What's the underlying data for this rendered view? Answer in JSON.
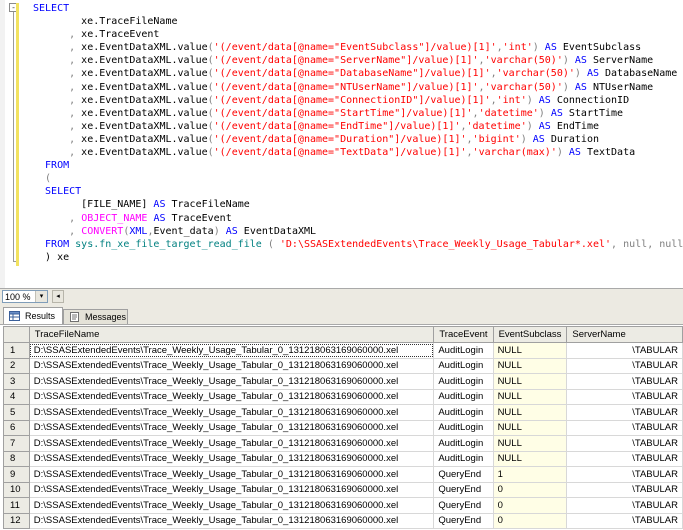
{
  "editor": {
    "collapse_glyph": "-",
    "lines": [
      [
        {
          "t": "SELECT",
          "c": "kw"
        }
      ],
      [
        {
          "t": "        xe.TraceFileName",
          "c": ""
        }
      ],
      [
        {
          "t": "      ",
          "c": ""
        },
        {
          "t": ",",
          "c": "gr"
        },
        {
          "t": " xe.TraceEvent",
          "c": ""
        }
      ],
      [
        {
          "t": "      ",
          "c": ""
        },
        {
          "t": ",",
          "c": "gr"
        },
        {
          "t": " xe.EventDataXML.value",
          "c": ""
        },
        {
          "t": "(",
          "c": "gr"
        },
        {
          "t": "'(/event/data[@name=\"EventSubclass\"]/value)[1]'",
          "c": "str"
        },
        {
          "t": ",",
          "c": "gr"
        },
        {
          "t": "'int'",
          "c": "str"
        },
        {
          "t": ") ",
          "c": "gr"
        },
        {
          "t": "AS",
          "c": "kw"
        },
        {
          "t": " EventSubclass",
          "c": ""
        }
      ],
      [
        {
          "t": "      ",
          "c": ""
        },
        {
          "t": ",",
          "c": "gr"
        },
        {
          "t": " xe.EventDataXML.value",
          "c": ""
        },
        {
          "t": "(",
          "c": "gr"
        },
        {
          "t": "'(/event/data[@name=\"ServerName\"]/value)[1]'",
          "c": "str"
        },
        {
          "t": ",",
          "c": "gr"
        },
        {
          "t": "'varchar(50)'",
          "c": "str"
        },
        {
          "t": ") ",
          "c": "gr"
        },
        {
          "t": "AS",
          "c": "kw"
        },
        {
          "t": " ServerName",
          "c": ""
        }
      ],
      [
        {
          "t": "      ",
          "c": ""
        },
        {
          "t": ",",
          "c": "gr"
        },
        {
          "t": " xe.EventDataXML.value",
          "c": ""
        },
        {
          "t": "(",
          "c": "gr"
        },
        {
          "t": "'(/event/data[@name=\"DatabaseName\"]/value)[1]'",
          "c": "str"
        },
        {
          "t": ",",
          "c": "gr"
        },
        {
          "t": "'varchar(50)'",
          "c": "str"
        },
        {
          "t": ") ",
          "c": "gr"
        },
        {
          "t": "AS",
          "c": "kw"
        },
        {
          "t": " DatabaseName",
          "c": ""
        }
      ],
      [
        {
          "t": "      ",
          "c": ""
        },
        {
          "t": ",",
          "c": "gr"
        },
        {
          "t": " xe.EventDataXML.value",
          "c": ""
        },
        {
          "t": "(",
          "c": "gr"
        },
        {
          "t": "'(/event/data[@name=\"NTUserName\"]/value)[1]'",
          "c": "str"
        },
        {
          "t": ",",
          "c": "gr"
        },
        {
          "t": "'varchar(50)'",
          "c": "str"
        },
        {
          "t": ") ",
          "c": "gr"
        },
        {
          "t": "AS",
          "c": "kw"
        },
        {
          "t": " NTUserName",
          "c": ""
        }
      ],
      [
        {
          "t": "      ",
          "c": ""
        },
        {
          "t": ",",
          "c": "gr"
        },
        {
          "t": " xe.EventDataXML.value",
          "c": ""
        },
        {
          "t": "(",
          "c": "gr"
        },
        {
          "t": "'(/event/data[@name=\"ConnectionID\"]/value)[1]'",
          "c": "str"
        },
        {
          "t": ",",
          "c": "gr"
        },
        {
          "t": "'int'",
          "c": "str"
        },
        {
          "t": ") ",
          "c": "gr"
        },
        {
          "t": "AS",
          "c": "kw"
        },
        {
          "t": " ConnectionID",
          "c": ""
        }
      ],
      [
        {
          "t": "      ",
          "c": ""
        },
        {
          "t": ",",
          "c": "gr"
        },
        {
          "t": " xe.EventDataXML.value",
          "c": ""
        },
        {
          "t": "(",
          "c": "gr"
        },
        {
          "t": "'(/event/data[@name=\"StartTime\"]/value)[1]'",
          "c": "str"
        },
        {
          "t": ",",
          "c": "gr"
        },
        {
          "t": "'datetime'",
          "c": "str"
        },
        {
          "t": ") ",
          "c": "gr"
        },
        {
          "t": "AS",
          "c": "kw"
        },
        {
          "t": " StartTime",
          "c": ""
        }
      ],
      [
        {
          "t": "      ",
          "c": ""
        },
        {
          "t": ",",
          "c": "gr"
        },
        {
          "t": " xe.EventDataXML.value",
          "c": ""
        },
        {
          "t": "(",
          "c": "gr"
        },
        {
          "t": "'(/event/data[@name=\"EndTime\"]/value)[1]'",
          "c": "str"
        },
        {
          "t": ",",
          "c": "gr"
        },
        {
          "t": "'datetime'",
          "c": "str"
        },
        {
          "t": ") ",
          "c": "gr"
        },
        {
          "t": "AS",
          "c": "kw"
        },
        {
          "t": " EndTime",
          "c": ""
        }
      ],
      [
        {
          "t": "      ",
          "c": ""
        },
        {
          "t": ",",
          "c": "gr"
        },
        {
          "t": " xe.EventDataXML.value",
          "c": ""
        },
        {
          "t": "(",
          "c": "gr"
        },
        {
          "t": "'(/event/data[@name=\"Duration\"]/value)[1]'",
          "c": "str"
        },
        {
          "t": ",",
          "c": "gr"
        },
        {
          "t": "'bigint'",
          "c": "str"
        },
        {
          "t": ") ",
          "c": "gr"
        },
        {
          "t": "AS",
          "c": "kw"
        },
        {
          "t": " Duration",
          "c": ""
        }
      ],
      [
        {
          "t": "      ",
          "c": ""
        },
        {
          "t": ",",
          "c": "gr"
        },
        {
          "t": " xe.EventDataXML.value",
          "c": ""
        },
        {
          "t": "(",
          "c": "gr"
        },
        {
          "t": "'(/event/data[@name=\"TextData\"]/value)[1]'",
          "c": "str"
        },
        {
          "t": ",",
          "c": "gr"
        },
        {
          "t": "'varchar(max)'",
          "c": "str"
        },
        {
          "t": ") ",
          "c": "gr"
        },
        {
          "t": "AS",
          "c": "kw"
        },
        {
          "t": " TextData",
          "c": ""
        }
      ],
      [
        {
          "t": "  FROM",
          "c": "kw"
        }
      ],
      [
        {
          "t": "  (",
          "c": "gr"
        }
      ],
      [
        {
          "t": "  SELECT",
          "c": "kw"
        }
      ],
      [
        {
          "t": "        [FILE_NAME] ",
          "c": ""
        },
        {
          "t": "AS",
          "c": "kw"
        },
        {
          "t": " TraceFileName",
          "c": ""
        }
      ],
      [
        {
          "t": "      ",
          "c": ""
        },
        {
          "t": ",",
          "c": "gr"
        },
        {
          "t": " ",
          "c": ""
        },
        {
          "t": "OBJECT_NAME",
          "c": "fn"
        },
        {
          "t": " ",
          "c": ""
        },
        {
          "t": "AS",
          "c": "kw"
        },
        {
          "t": " TraceEvent",
          "c": ""
        }
      ],
      [
        {
          "t": "      ",
          "c": ""
        },
        {
          "t": ",",
          "c": "gr"
        },
        {
          "t": " ",
          "c": ""
        },
        {
          "t": "CONVERT",
          "c": "fn"
        },
        {
          "t": "(",
          "c": "gr"
        },
        {
          "t": "XML",
          "c": "kw"
        },
        {
          "t": ",",
          "c": "gr"
        },
        {
          "t": "Event_data",
          "c": ""
        },
        {
          "t": ") ",
          "c": "gr"
        },
        {
          "t": "AS",
          "c": "kw"
        },
        {
          "t": " EventDataXML",
          "c": ""
        }
      ],
      [
        {
          "t": "  FROM",
          "c": "kw"
        },
        {
          "t": " ",
          "c": ""
        },
        {
          "t": "sys.fn_xe_file_target_read_file",
          "c": "nm"
        },
        {
          "t": " ",
          "c": ""
        },
        {
          "t": "(",
          "c": "gr"
        },
        {
          "t": " ",
          "c": ""
        },
        {
          "t": "'D:\\SSASExtendedEvents\\Trace_Weekly_Usage_Tabular*.xel'",
          "c": "str"
        },
        {
          "t": ",",
          "c": "gr"
        },
        {
          "t": " ",
          "c": ""
        },
        {
          "t": "null",
          "c": "gr"
        },
        {
          "t": ",",
          "c": "gr"
        },
        {
          "t": " ",
          "c": ""
        },
        {
          "t": "null",
          "c": "gr"
        },
        {
          "t": ",",
          "c": "gr"
        },
        {
          "t": " ",
          "c": ""
        },
        {
          "t": "null",
          "c": "gr"
        },
        {
          "t": " )",
          "c": "gr"
        }
      ],
      [
        {
          "t": "  ) xe",
          "c": ""
        }
      ]
    ]
  },
  "zoom": {
    "value": "100 %",
    "arrow": "▾",
    "scroll_left": "◂"
  },
  "tabs": [
    {
      "label": "Results",
      "active": true
    },
    {
      "label": "Messages",
      "active": false
    }
  ],
  "grid": {
    "columns": [
      "TraceFileName",
      "TraceEvent",
      "EventSubclass",
      "ServerName"
    ],
    "selected_row": 0,
    "rows": [
      {
        "n": "1",
        "file": "D:\\SSASExtendedEvents\\Trace_Weekly_Usage_Tabular_0_131218063169060000.xel",
        "event": "AuditLogin",
        "sub": "NULL",
        "server": "\\TABULAR"
      },
      {
        "n": "2",
        "file": "D:\\SSASExtendedEvents\\Trace_Weekly_Usage_Tabular_0_131218063169060000.xel",
        "event": "AuditLogin",
        "sub": "NULL",
        "server": "\\TABULAR"
      },
      {
        "n": "3",
        "file": "D:\\SSASExtendedEvents\\Trace_Weekly_Usage_Tabular_0_131218063169060000.xel",
        "event": "AuditLogin",
        "sub": "NULL",
        "server": "\\TABULAR"
      },
      {
        "n": "4",
        "file": "D:\\SSASExtendedEvents\\Trace_Weekly_Usage_Tabular_0_131218063169060000.xel",
        "event": "AuditLogin",
        "sub": "NULL",
        "server": "\\TABULAR"
      },
      {
        "n": "5",
        "file": "D:\\SSASExtendedEvents\\Trace_Weekly_Usage_Tabular_0_131218063169060000.xel",
        "event": "AuditLogin",
        "sub": "NULL",
        "server": "\\TABULAR"
      },
      {
        "n": "6",
        "file": "D:\\SSASExtendedEvents\\Trace_Weekly_Usage_Tabular_0_131218063169060000.xel",
        "event": "AuditLogin",
        "sub": "NULL",
        "server": "\\TABULAR"
      },
      {
        "n": "7",
        "file": "D:\\SSASExtendedEvents\\Trace_Weekly_Usage_Tabular_0_131218063169060000.xel",
        "event": "AuditLogin",
        "sub": "NULL",
        "server": "\\TABULAR"
      },
      {
        "n": "8",
        "file": "D:\\SSASExtendedEvents\\Trace_Weekly_Usage_Tabular_0_131218063169060000.xel",
        "event": "AuditLogin",
        "sub": "NULL",
        "server": "\\TABULAR"
      },
      {
        "n": "9",
        "file": "D:\\SSASExtendedEvents\\Trace_Weekly_Usage_Tabular_0_131218063169060000.xel",
        "event": "QueryEnd",
        "sub": "1",
        "server": "\\TABULAR"
      },
      {
        "n": "10",
        "file": "D:\\SSASExtendedEvents\\Trace_Weekly_Usage_Tabular_0_131218063169060000.xel",
        "event": "QueryEnd",
        "sub": "0",
        "server": "\\TABULAR"
      },
      {
        "n": "11",
        "file": "D:\\SSASExtendedEvents\\Trace_Weekly_Usage_Tabular_0_131218063169060000.xel",
        "event": "QueryEnd",
        "sub": "0",
        "server": "\\TABULAR"
      },
      {
        "n": "12",
        "file": "D:\\SSASExtendedEvents\\Trace_Weekly_Usage_Tabular_0_131218063169060000.xel",
        "event": "QueryEnd",
        "sub": "0",
        "server": "\\TABULAR"
      }
    ]
  }
}
